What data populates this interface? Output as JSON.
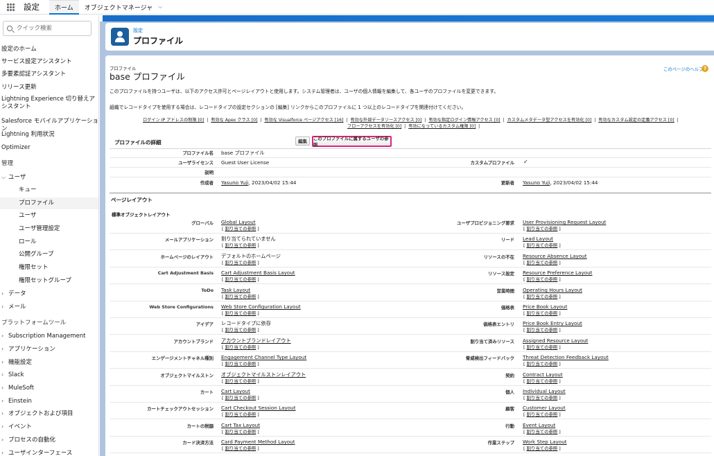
{
  "topbar": {
    "app_name": "設定",
    "tabs": [
      {
        "label": "ホーム",
        "active": true
      },
      {
        "label": "オブジェクトマネージャ",
        "active": false
      }
    ]
  },
  "sidebar": {
    "search_placeholder": "クイック検索",
    "items": [
      {
        "label": "設定のホーム",
        "type": "link"
      },
      {
        "label": "サービス設定アシスタント",
        "type": "link"
      },
      {
        "label": "多要素認証アシスタント",
        "type": "link"
      },
      {
        "label": "リリース更新",
        "type": "link"
      },
      {
        "label": "Lightning Experience 切り替えアシスタント",
        "type": "link"
      },
      {
        "label": "Salesforce モバイルアプリケーション",
        "type": "link"
      },
      {
        "label": "Lightning 利用状況",
        "type": "link"
      },
      {
        "label": "Optimizer",
        "type": "link"
      },
      {
        "label": "管理",
        "type": "section"
      },
      {
        "label": "ユーザ",
        "type": "group-open"
      },
      {
        "label": "キュー",
        "type": "sub"
      },
      {
        "label": "プロファイル",
        "type": "sub-selected"
      },
      {
        "label": "ユーザ",
        "type": "sub"
      },
      {
        "label": "ユーザ管理設定",
        "type": "sub"
      },
      {
        "label": "ロール",
        "type": "sub"
      },
      {
        "label": "公開グループ",
        "type": "sub"
      },
      {
        "label": "権限セット",
        "type": "sub"
      },
      {
        "label": "権限セットグループ",
        "type": "sub"
      },
      {
        "label": "データ",
        "type": "group"
      },
      {
        "label": "メール",
        "type": "group"
      },
      {
        "label": "プラットフォームツール",
        "type": "section"
      },
      {
        "label": "Subscription Management",
        "type": "group"
      },
      {
        "label": "アプリケーション",
        "type": "group"
      },
      {
        "label": "機能設定",
        "type": "group"
      },
      {
        "label": "Slack",
        "type": "group"
      },
      {
        "label": "MuleSoft",
        "type": "group"
      },
      {
        "label": "Einstein",
        "type": "group"
      },
      {
        "label": "オブジェクトおよび項目",
        "type": "group"
      },
      {
        "label": "イベント",
        "type": "group"
      },
      {
        "label": "プロセスの自動化",
        "type": "group"
      },
      {
        "label": "ユーザインターフェース",
        "type": "group"
      }
    ]
  },
  "header": {
    "breadcrumb": "設定",
    "title": "プロファイル"
  },
  "profile": {
    "small_label": "プロファイル",
    "title": "base プロファイル",
    "help_link": "このページのヘルプ",
    "desc1": "このプロファイルを持つユーザは、以下のアクセス許可とページレイアウトと使用します。システム管理者は、ユーザの個人情報を編集して、各ユーザのプロファイルを変更できます。",
    "desc2": "組織でレコードタイプを使用する場合は、レコードタイプの設定セクションの [編集] リンクからこのプロファイルに 1 つ以上のレコードタイプを関連付けてください。",
    "links_row1": [
      "ログイン IP アドレスの制限 [0]",
      "有効な Apex クラス [0]",
      "有効な Visualforce ページアクセス [16]",
      "有効な外部データソースアクセス [0]",
      "有効な指定ログイン情報アクセス [0]",
      "カスタムメタデータ型アクセスを有効化 [0]",
      "有効なカスタム設定の定義アクセス [0]"
    ],
    "links_row2": [
      "フローアクセスを有効化 [0]",
      "有効になっているカスタム権限 [0]"
    ],
    "details_title": "プロファイルの詳細",
    "edit_btn": "編集",
    "view_users_btn": "このプロファイルに属するユーザの参照",
    "fields": {
      "name_label": "プロファイル名",
      "name_value": "base プロファイル",
      "license_label": "ユーザライセンス",
      "license_value": "Guest User License",
      "custom_label": "カスタムプロファイル",
      "custom_value": "✓",
      "desc_label": "説明",
      "created_label": "作成者",
      "created_user": "Yasuno Yuji",
      "created_date": ", 2023/04/02 15:44",
      "modified_label": "更新者",
      "modified_user": "Yasuno Yuji",
      "modified_date": ", 2023/04/02 15:44"
    },
    "layout_section": "ページレイアウト",
    "std_layout_title": "標準オブジェクトレイアウト",
    "assign_link": "[ 割り当ての参照 ]",
    "rows": [
      {
        "l": "グローバル",
        "lv": "Global Layout",
        "lu": true,
        "r": "ユーザプロビジョニング要求",
        "rv": "User Provisioning Request Layout",
        "ru": true
      },
      {
        "l": "メールアプリケーション",
        "lv": "割り当てられていません",
        "lu": false,
        "r": "リード",
        "rv": "Lead Layout",
        "ru": true
      },
      {
        "l": "ホームページのレイアウト",
        "lv": "デフォルトのホームページ",
        "lu": false,
        "r": "リソースの不在",
        "rv": "Resource Absence Layout",
        "ru": true
      },
      {
        "l": "Cart Adjustment Basis",
        "lv": "Cart Adjustment Basis Layout",
        "lu": true,
        "r": "リソース設定",
        "rv": "Resource Preference Layout",
        "ru": true
      },
      {
        "l": "ToDo",
        "lv": "Task Layout",
        "lu": true,
        "r": "営業時間",
        "rv": "Operating Hours Layout",
        "ru": true
      },
      {
        "l": "Web Store Configurations",
        "lv": "Web Store Configuration Layout",
        "lu": true,
        "r": "価格表",
        "rv": "Price Book Layout",
        "ru": true
      },
      {
        "l": "アイデア",
        "lv": "レコードタイプに依存",
        "lu": false,
        "r": "価格表エントリ",
        "rv": "Price Book Entry Layout",
        "ru": true
      },
      {
        "l": "アカウントブランド",
        "lv": "アカウントブランドレイアウト",
        "lu": true,
        "r": "割り当て済みリソース",
        "rv": "Assigned Resource Layout",
        "ru": true
      },
      {
        "l": "エンゲージメントチャネル種別",
        "lv": "Engagement Channel Type Layout",
        "lu": true,
        "r": "脅威検出フィードバック",
        "rv": "Threat Detection Feedback Layout",
        "ru": true
      },
      {
        "l": "オブジェクトマイルストン",
        "lv": "オブジェクトマイルストンレイアウト",
        "lu": true,
        "r": "契約",
        "rv": "Contract Layout",
        "ru": true
      },
      {
        "l": "カート",
        "lv": "Cart Layout",
        "lu": true,
        "r": "個人",
        "rv": "Individual Layout",
        "ru": true
      },
      {
        "l": "カートチェックアウトセッション",
        "lv": "Cart Checkout Session Layout",
        "lu": true,
        "r": "顧客",
        "rv": "Customer Layout",
        "ru": true
      },
      {
        "l": "カートの税額",
        "lv": "Cart Tax Layout",
        "lu": true,
        "r": "行動",
        "rv": "Event Layout",
        "ru": true
      },
      {
        "l": "カード決済方法",
        "lv": "Card Payment Method Layout",
        "lu": true,
        "r": "作業ステップ",
        "rv": "Work Step Layout",
        "ru": true
      }
    ]
  }
}
